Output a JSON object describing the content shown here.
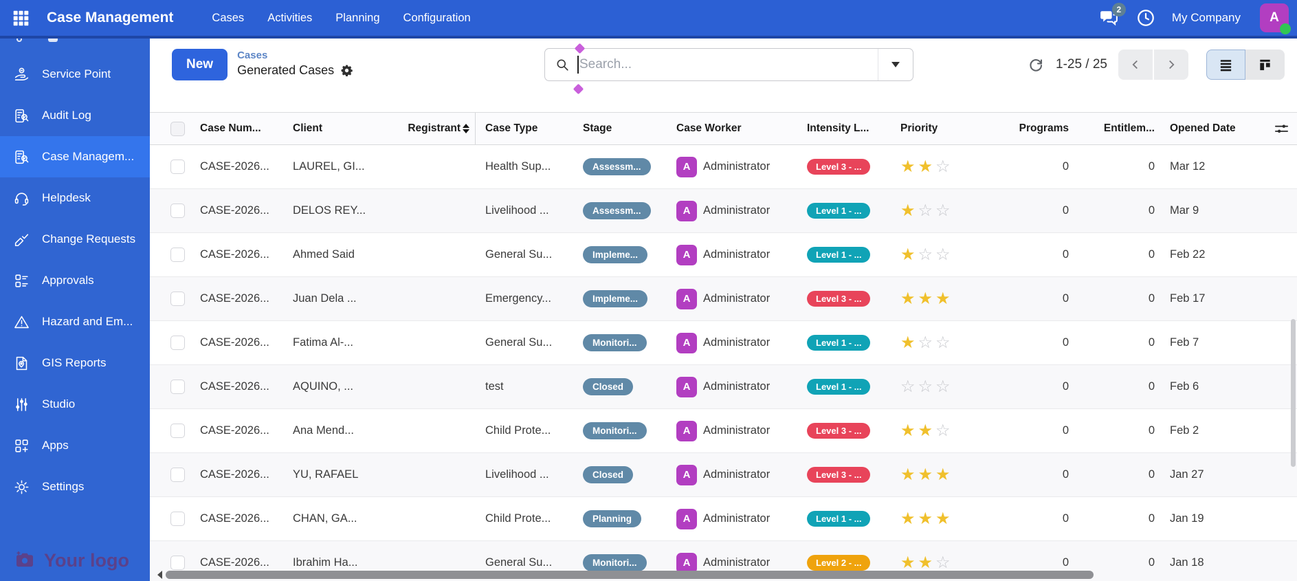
{
  "topbar": {
    "app_title": "Case Management",
    "menu_items": [
      "Cases",
      "Activities",
      "Planning",
      "Configuration"
    ],
    "messages_badge_count": "2",
    "company_name": "My Company",
    "user_avatar_letter": "A"
  },
  "sidebar": {
    "items": [
      {
        "label": "Service Point",
        "icon": "service-point",
        "selected": false
      },
      {
        "label": "Audit Log",
        "icon": "audit-log",
        "selected": false
      },
      {
        "label": "Case Managem...",
        "icon": "case-management",
        "selected": true
      },
      {
        "label": "Helpdesk",
        "icon": "helpdesk",
        "selected": false
      },
      {
        "label": "Change Requests",
        "icon": "change-requests",
        "selected": false
      },
      {
        "label": "Approvals",
        "icon": "approvals",
        "selected": false
      },
      {
        "label": "Hazard and Em...",
        "icon": "hazard",
        "selected": false
      },
      {
        "label": "GIS Reports",
        "icon": "gis-reports",
        "selected": false
      },
      {
        "label": "Studio",
        "icon": "studio",
        "selected": false
      },
      {
        "label": "Apps",
        "icon": "apps",
        "selected": false
      },
      {
        "label": "Settings",
        "icon": "settings",
        "selected": false
      }
    ],
    "logo_text": "Your logo"
  },
  "control_panel": {
    "new_button_label": "New",
    "breadcrumb_parent": "Cases",
    "breadcrumb_current": "Generated Cases",
    "search_placeholder": "Search...",
    "pagination_text": "1-25 / 25"
  },
  "table": {
    "headers": {
      "case_number": "Case Num...",
      "client": "Client",
      "registrant": "Registrant",
      "case_type": "Case Type",
      "stage": "Stage",
      "case_worker": "Case Worker",
      "intensity_level": "Intensity L...",
      "priority": "Priority",
      "programs": "Programs",
      "entitlements": "Entitlem...",
      "opened_date": "Opened Date"
    },
    "priority_max_stars": 3,
    "rows": [
      {
        "case_number": "CASE-2026...",
        "client": "LAUREL, GI...",
        "registrant": "",
        "case_type": "Health Sup...",
        "stage": "Assessm...",
        "case_worker": "Administrator",
        "intensity": {
          "label": "Level 3 - ...",
          "color": "red"
        },
        "priority_stars": 2,
        "programs": "0",
        "entitlements": "0",
        "opened_date": "Mar 12"
      },
      {
        "case_number": "CASE-2026...",
        "client": "DELOS REY...",
        "registrant": "",
        "case_type": "Livelihood ...",
        "stage": "Assessm...",
        "case_worker": "Administrator",
        "intensity": {
          "label": "Level 1 - ...",
          "color": "teal"
        },
        "priority_stars": 1,
        "programs": "0",
        "entitlements": "0",
        "opened_date": "Mar 9"
      },
      {
        "case_number": "CASE-2026...",
        "client": "Ahmed Said",
        "registrant": "",
        "case_type": "General Su...",
        "stage": "Impleme...",
        "case_worker": "Administrator",
        "intensity": {
          "label": "Level 1 - ...",
          "color": "teal"
        },
        "priority_stars": 1,
        "programs": "0",
        "entitlements": "0",
        "opened_date": "Feb 22"
      },
      {
        "case_number": "CASE-2026...",
        "client": "Juan Dela ...",
        "registrant": "",
        "case_type": "Emergency...",
        "stage": "Impleme...",
        "case_worker": "Administrator",
        "intensity": {
          "label": "Level 3 - ...",
          "color": "red"
        },
        "priority_stars": 3,
        "programs": "0",
        "entitlements": "0",
        "opened_date": "Feb 17"
      },
      {
        "case_number": "CASE-2026...",
        "client": "Fatima Al-...",
        "registrant": "",
        "case_type": "General Su...",
        "stage": "Monitori...",
        "case_worker": "Administrator",
        "intensity": {
          "label": "Level 1 - ...",
          "color": "teal"
        },
        "priority_stars": 1,
        "programs": "0",
        "entitlements": "0",
        "opened_date": "Feb 7"
      },
      {
        "case_number": "CASE-2026...",
        "client": "AQUINO, ...",
        "registrant": "",
        "case_type": "test",
        "stage": "Closed",
        "case_worker": "Administrator",
        "intensity": {
          "label": "Level 1 - ...",
          "color": "teal"
        },
        "priority_stars": 0,
        "programs": "0",
        "entitlements": "0",
        "opened_date": "Feb 6"
      },
      {
        "case_number": "CASE-2026...",
        "client": "Ana Mend...",
        "registrant": "",
        "case_type": "Child Prote...",
        "stage": "Monitori...",
        "case_worker": "Administrator",
        "intensity": {
          "label": "Level 3 - ...",
          "color": "red"
        },
        "priority_stars": 2,
        "programs": "0",
        "entitlements": "0",
        "opened_date": "Feb 2"
      },
      {
        "case_number": "CASE-2026...",
        "client": "YU, RAFAEL",
        "registrant": "",
        "case_type": "Livelihood ...",
        "stage": "Closed",
        "case_worker": "Administrator",
        "intensity": {
          "label": "Level 3 - ...",
          "color": "red"
        },
        "priority_stars": 3,
        "programs": "0",
        "entitlements": "0",
        "opened_date": "Jan 27"
      },
      {
        "case_number": "CASE-2026...",
        "client": "CHAN, GA...",
        "registrant": "",
        "case_type": "Child Prote...",
        "stage": "Planning",
        "case_worker": "Administrator",
        "intensity": {
          "label": "Level 1 - ...",
          "color": "teal"
        },
        "priority_stars": 3,
        "programs": "0",
        "entitlements": "0",
        "opened_date": "Jan 19"
      },
      {
        "case_number": "CASE-2026...",
        "client": "Ibrahim Ha...",
        "registrant": "",
        "case_type": "General Su...",
        "stage": "Monitori...",
        "case_worker": "Administrator",
        "intensity": {
          "label": "Level 2 - ...",
          "color": "amber"
        },
        "priority_stars": 2,
        "programs": "0",
        "entitlements": "0",
        "opened_date": "Jan 18"
      }
    ]
  },
  "colors": {
    "topbar_blue": "#2c60d4",
    "sidebar_blue": "#3065d2",
    "sidebar_selected_blue": "#3475ec",
    "primary_button_blue": "#2e64dd",
    "stage_badge": "#6089a7",
    "intensity_red": "#e8445a",
    "intensity_teal": "#10a3b6",
    "intensity_amber": "#efa30d",
    "star_gold": "#f0c02c",
    "avatar_magenta": "#b23ec1",
    "online_green": "#31c653",
    "marker_magenta": "#c95fdb"
  }
}
